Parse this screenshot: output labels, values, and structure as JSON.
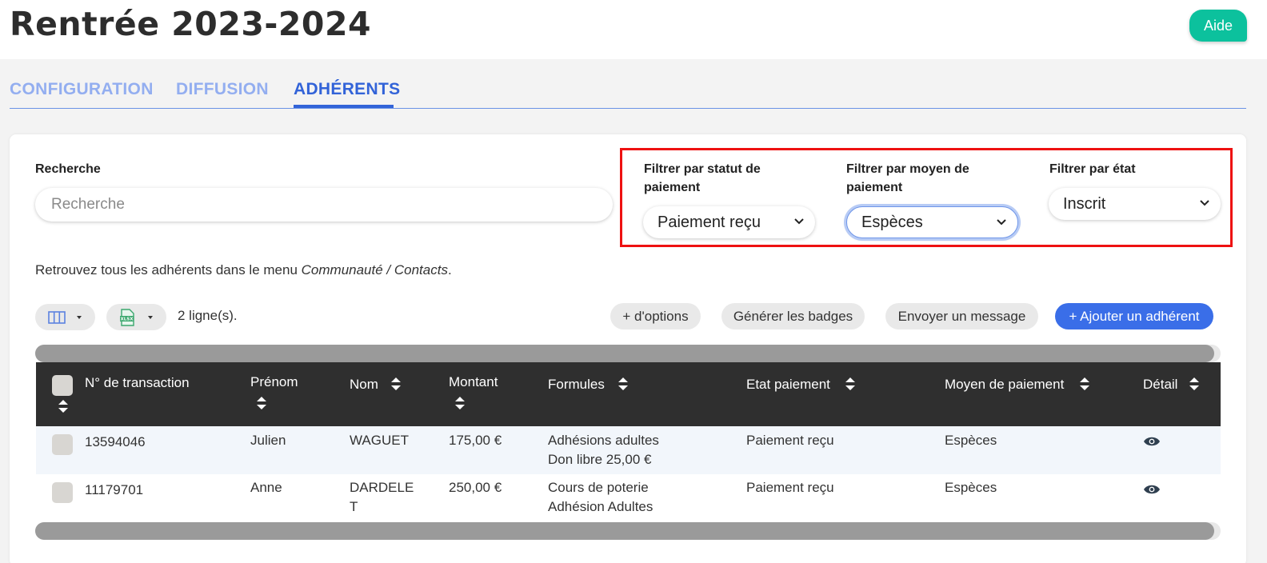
{
  "header": {
    "title": "Rentrée 2023-2024",
    "help_label": "Aide"
  },
  "tabs": [
    {
      "label": "CONFIGURATION",
      "active": false
    },
    {
      "label": "DIFFUSION",
      "active": false
    },
    {
      "label": "ADHÉRENTS",
      "active": true
    }
  ],
  "search": {
    "label": "Recherche",
    "placeholder": "Recherche",
    "value": ""
  },
  "filters": {
    "payment_status": {
      "label_line1": "Filtrer par statut de",
      "label_line2": "paiement",
      "value": "Paiement reçu"
    },
    "payment_method": {
      "label_line1": "Filtrer par moyen de",
      "label_line2": "paiement",
      "value": "Espèces"
    },
    "state": {
      "label": "Filtrer par état",
      "value": "Inscrit"
    }
  },
  "info": {
    "prefix": "Retrouvez tous les adhérents dans le menu ",
    "menu_path": "Communauté / Contacts",
    "suffix": "."
  },
  "toolbar": {
    "rows_count": "2 ligne(s).",
    "more_options": "+ d'options",
    "generate_badges": "Générer les badges",
    "send_message": "Envoyer un message",
    "add_member": "+ Ajouter un adhérent",
    "xlsx_label": "XLSX"
  },
  "table": {
    "columns": [
      "N° de transaction",
      "Prénom",
      "Nom",
      "Montant",
      "Formules",
      "Etat paiement",
      "Moyen de paiement",
      "Détail"
    ],
    "rows": [
      {
        "transaction": "13594046",
        "first_name": "Julien",
        "last_name_1": "WAGUET",
        "last_name_2": "",
        "amount": "175,00 €",
        "formula_1": "Adhésions adultes",
        "formula_2": "Don libre 25,00 €",
        "status": "Paiement reçu",
        "method": "Espèces"
      },
      {
        "transaction": "11179701",
        "first_name": "Anne",
        "last_name_1": "DARDELE",
        "last_name_2": "T",
        "amount": "250,00 €",
        "formula_1": "Cours de poterie",
        "formula_2": "Adhésion Adultes",
        "status": "Paiement reçu",
        "method": "Espèces"
      }
    ]
  },
  "colors": {
    "accent": "#3263d8",
    "help": "#0cc19d",
    "highlight": "#ee1111",
    "table_header": "#2f2f2f"
  }
}
